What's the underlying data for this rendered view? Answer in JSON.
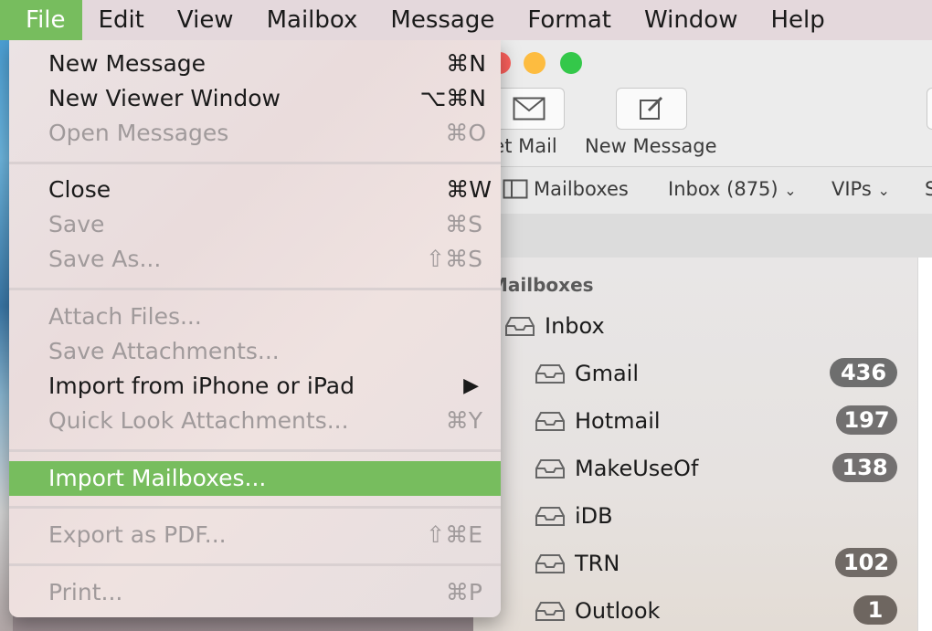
{
  "menubar": {
    "items": [
      "File",
      "Edit",
      "View",
      "Mailbox",
      "Message",
      "Format",
      "Window",
      "Help"
    ],
    "active_index": 0
  },
  "file_menu": {
    "groups": [
      [
        {
          "label": "New Message",
          "shortcut": "⌘N",
          "enabled": true
        },
        {
          "label": "New Viewer Window",
          "shortcut": "⌥⌘N",
          "enabled": true
        },
        {
          "label": "Open Messages",
          "shortcut": "⌘O",
          "enabled": false
        }
      ],
      [
        {
          "label": "Close",
          "shortcut": "⌘W",
          "enabled": true
        },
        {
          "label": "Save",
          "shortcut": "⌘S",
          "enabled": false
        },
        {
          "label": "Save As...",
          "shortcut": "⇧⌘S",
          "enabled": false
        }
      ],
      [
        {
          "label": "Attach Files...",
          "shortcut": "",
          "enabled": false
        },
        {
          "label": "Save Attachments...",
          "shortcut": "",
          "enabled": false
        },
        {
          "label": "Import from iPhone or iPad",
          "shortcut": "▶",
          "enabled": true
        },
        {
          "label": "Quick Look Attachments...",
          "shortcut": "⌘Y",
          "enabled": false
        }
      ],
      [
        {
          "label": "Import Mailboxes...",
          "shortcut": "",
          "enabled": true,
          "highlighted": true
        }
      ],
      [
        {
          "label": "Export as PDF...",
          "shortcut": "⇧⌘E",
          "enabled": false
        }
      ],
      [
        {
          "label": "Print...",
          "shortcut": "⌘P",
          "enabled": false
        }
      ]
    ]
  },
  "mail_window": {
    "toolbar": {
      "get_mail_label": "Get Mail",
      "new_message_label": "New Message"
    },
    "favorites": {
      "mailboxes_label": "Mailboxes",
      "inbox_label": "Inbox (875)",
      "vips_label": "VIPs",
      "overflow_label": "S"
    },
    "sidebar": {
      "heading": "Mailboxes",
      "inbox_label": "Inbox",
      "accounts": [
        {
          "name": "Gmail",
          "count": "436"
        },
        {
          "name": "Hotmail",
          "count": "197"
        },
        {
          "name": "MakeUseOf",
          "count": "138"
        },
        {
          "name": "iDB",
          "count": ""
        },
        {
          "name": "TRN",
          "count": "102"
        },
        {
          "name": "Outlook",
          "count": "1"
        }
      ]
    },
    "colors": {
      "close": "#fc605c",
      "minimize": "#fdbc40",
      "zoom": "#34c84a",
      "highlight": "#77bd5e",
      "badge": "#7a7a7a"
    }
  }
}
